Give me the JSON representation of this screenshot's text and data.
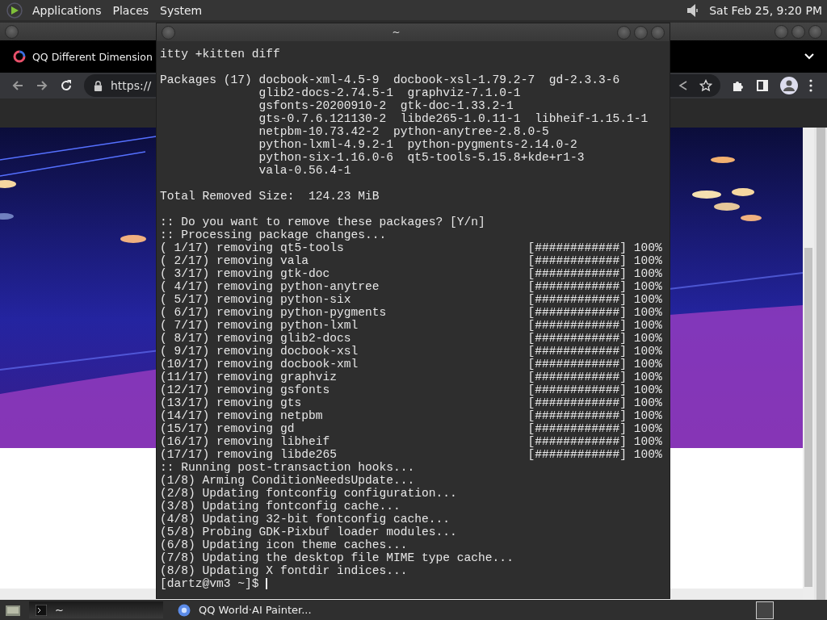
{
  "top_panel": {
    "menus": [
      "Applications",
      "Places",
      "System"
    ],
    "clock": "Sat Feb 25, 9:20 PM"
  },
  "browser": {
    "tab_title": "QQ Different Dimension",
    "url": "https://"
  },
  "terminal": {
    "title": "~",
    "command_tail": "itty +kitten diff",
    "packages": {
      "label": "Packages (17)",
      "lines": [
        "docbook-xml-4.5-9  docbook-xsl-1.79.2-7  gd-2.3.3-6",
        "glib2-docs-2.74.5-1  graphviz-7.1.0-1",
        "gsfonts-20200910-2  gtk-doc-1.33.2-1",
        "gts-0.7.6.121130-2  libde265-1.0.11-1  libheif-1.15.1-1",
        "netpbm-10.73.42-2  python-anytree-2.8.0-5",
        "python-lxml-4.9.2-1  python-pygments-2.14.0-2",
        "python-six-1.16.0-6  qt5-tools-5.15.8+kde+r1-3",
        "vala-0.56.4-1"
      ]
    },
    "total": "Total Removed Size:  124.23 MiB",
    "lines": [
      {
        "kind": "text",
        "text": ":: Do you want to remove these packages? [Y/n]"
      },
      {
        "kind": "text",
        "text": ":: Processing package changes..."
      },
      {
        "kind": "progress",
        "text": "( 1/17) removing qt5-tools",
        "bar": "[############]",
        "percent": "100%"
      },
      {
        "kind": "progress",
        "text": "( 2/17) removing vala",
        "bar": "[############]",
        "percent": "100%"
      },
      {
        "kind": "progress",
        "text": "( 3/17) removing gtk-doc",
        "bar": "[############]",
        "percent": "100%"
      },
      {
        "kind": "progress",
        "text": "( 4/17) removing python-anytree",
        "bar": "[############]",
        "percent": "100%"
      },
      {
        "kind": "progress",
        "text": "( 5/17) removing python-six",
        "bar": "[############]",
        "percent": "100%"
      },
      {
        "kind": "progress",
        "text": "( 6/17) removing python-pygments",
        "bar": "[############]",
        "percent": "100%"
      },
      {
        "kind": "progress",
        "text": "( 7/17) removing python-lxml",
        "bar": "[############]",
        "percent": "100%"
      },
      {
        "kind": "progress",
        "text": "( 8/17) removing glib2-docs",
        "bar": "[############]",
        "percent": "100%"
      },
      {
        "kind": "progress",
        "text": "( 9/17) removing docbook-xsl",
        "bar": "[############]",
        "percent": "100%"
      },
      {
        "kind": "progress",
        "text": "(10/17) removing docbook-xml",
        "bar": "[############]",
        "percent": "100%"
      },
      {
        "kind": "progress",
        "text": "(11/17) removing graphviz",
        "bar": "[############]",
        "percent": "100%"
      },
      {
        "kind": "progress",
        "text": "(12/17) removing gsfonts",
        "bar": "[############]",
        "percent": "100%"
      },
      {
        "kind": "progress",
        "text": "(13/17) removing gts",
        "bar": "[############]",
        "percent": "100%"
      },
      {
        "kind": "progress",
        "text": "(14/17) removing netpbm",
        "bar": "[############]",
        "percent": "100%"
      },
      {
        "kind": "progress",
        "text": "(15/17) removing gd",
        "bar": "[############]",
        "percent": "100%"
      },
      {
        "kind": "progress",
        "text": "(16/17) removing libheif",
        "bar": "[############]",
        "percent": "100%"
      },
      {
        "kind": "progress",
        "text": "(17/17) removing libde265",
        "bar": "[############]",
        "percent": "100%"
      },
      {
        "kind": "text",
        "text": ":: Running post-transaction hooks..."
      },
      {
        "kind": "text",
        "text": "(1/8) Arming ConditionNeedsUpdate..."
      },
      {
        "kind": "text",
        "text": "(2/8) Updating fontconfig configuration..."
      },
      {
        "kind": "text",
        "text": "(3/8) Updating fontconfig cache..."
      },
      {
        "kind": "text",
        "text": "(4/8) Updating 32-bit fontconfig cache..."
      },
      {
        "kind": "text",
        "text": "(5/8) Probing GDK-Pixbuf loader modules..."
      },
      {
        "kind": "text",
        "text": "(6/8) Updating icon theme caches..."
      },
      {
        "kind": "text",
        "text": "(7/8) Updating the desktop file MIME type cache..."
      },
      {
        "kind": "text",
        "text": "(8/8) Updating X fontdir indices..."
      },
      {
        "kind": "prompt",
        "text": "[dartz@vm3 ~]$ "
      }
    ]
  },
  "taskbar": {
    "tasks": [
      {
        "kind": "terminal",
        "label": "~",
        "selected": true
      },
      {
        "kind": "browser",
        "label": "QQ World·AI Painter...",
        "selected": false
      }
    ]
  }
}
